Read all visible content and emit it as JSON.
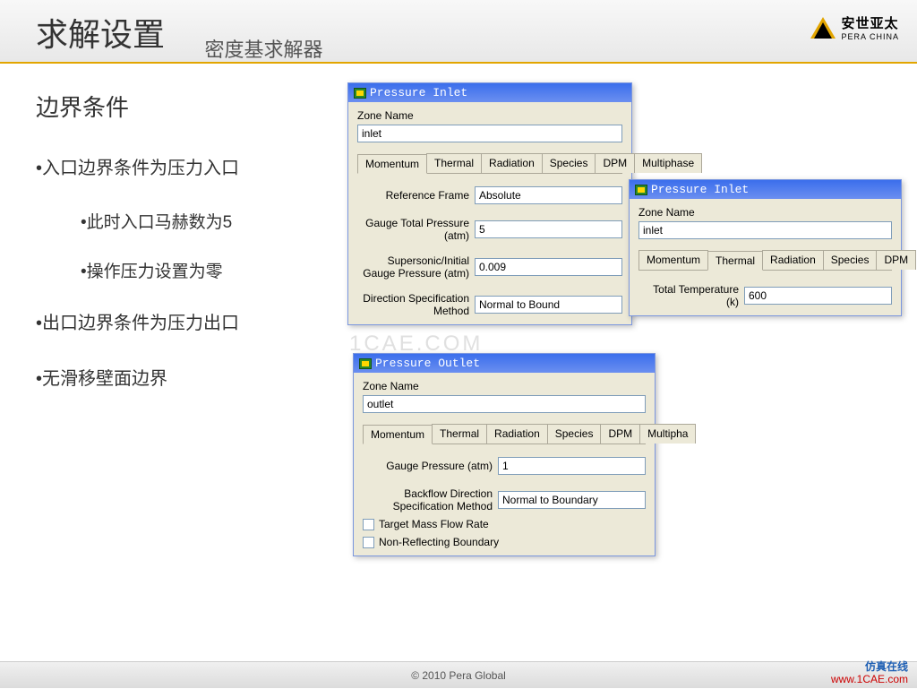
{
  "header": {
    "title_main": "求解设置",
    "title_sub": "密度基求解器",
    "logo_cn": "安世亚太",
    "logo_en": "PERA CHINA"
  },
  "slide": {
    "section_title": "边界条件",
    "bullets": {
      "b1": "•入口边界条件为压力入口",
      "b1a": "•此时入口马赫数为5",
      "b1b": "•操作压力设置为零",
      "b2": "•出口边界条件为压力出口",
      "b3": "•无滑移壁面边界"
    }
  },
  "dlg1": {
    "title": "Pressure Inlet",
    "zone_label": "Zone Name",
    "zone_value": "inlet",
    "tabs": [
      "Momentum",
      "Thermal",
      "Radiation",
      "Species",
      "DPM",
      "Multiphase"
    ],
    "active_tab": 0,
    "fields": {
      "ref_frame_label": "Reference Frame",
      "ref_frame_value": "Absolute",
      "gauge_total_label": "Gauge Total Pressure (atm)",
      "gauge_total_value": "5",
      "supersonic_label": "Supersonic/Initial Gauge Pressure (atm)",
      "supersonic_value": "0.009",
      "direction_label": "Direction Specification Method",
      "direction_value": "Normal to Bound"
    }
  },
  "dlg2": {
    "title": "Pressure Inlet",
    "zone_label": "Zone Name",
    "zone_value": "inlet",
    "tabs": [
      "Momentum",
      "Thermal",
      "Radiation",
      "Species",
      "DPM"
    ],
    "active_tab": 1,
    "fields": {
      "total_temp_label": "Total Temperature (k)",
      "total_temp_value": "600"
    }
  },
  "dlg3": {
    "title": "Pressure Outlet",
    "zone_label": "Zone Name",
    "zone_value": "outlet",
    "tabs": [
      "Momentum",
      "Thermal",
      "Radiation",
      "Species",
      "DPM",
      "Multipha"
    ],
    "active_tab": 0,
    "fields": {
      "gauge_label": "Gauge Pressure (atm)",
      "gauge_value": "1",
      "backflow_label": "Backflow Direction Specification Method",
      "backflow_value": "Normal to Boundary",
      "chk1": "Target Mass Flow Rate",
      "chk2": "Non-Reflecting Boundary"
    }
  },
  "watermark": "1CAE.COM",
  "footer": {
    "copyright": "© 2010 Pera Global",
    "link1": "仿真在线",
    "link2": "www.1CAE.com"
  }
}
